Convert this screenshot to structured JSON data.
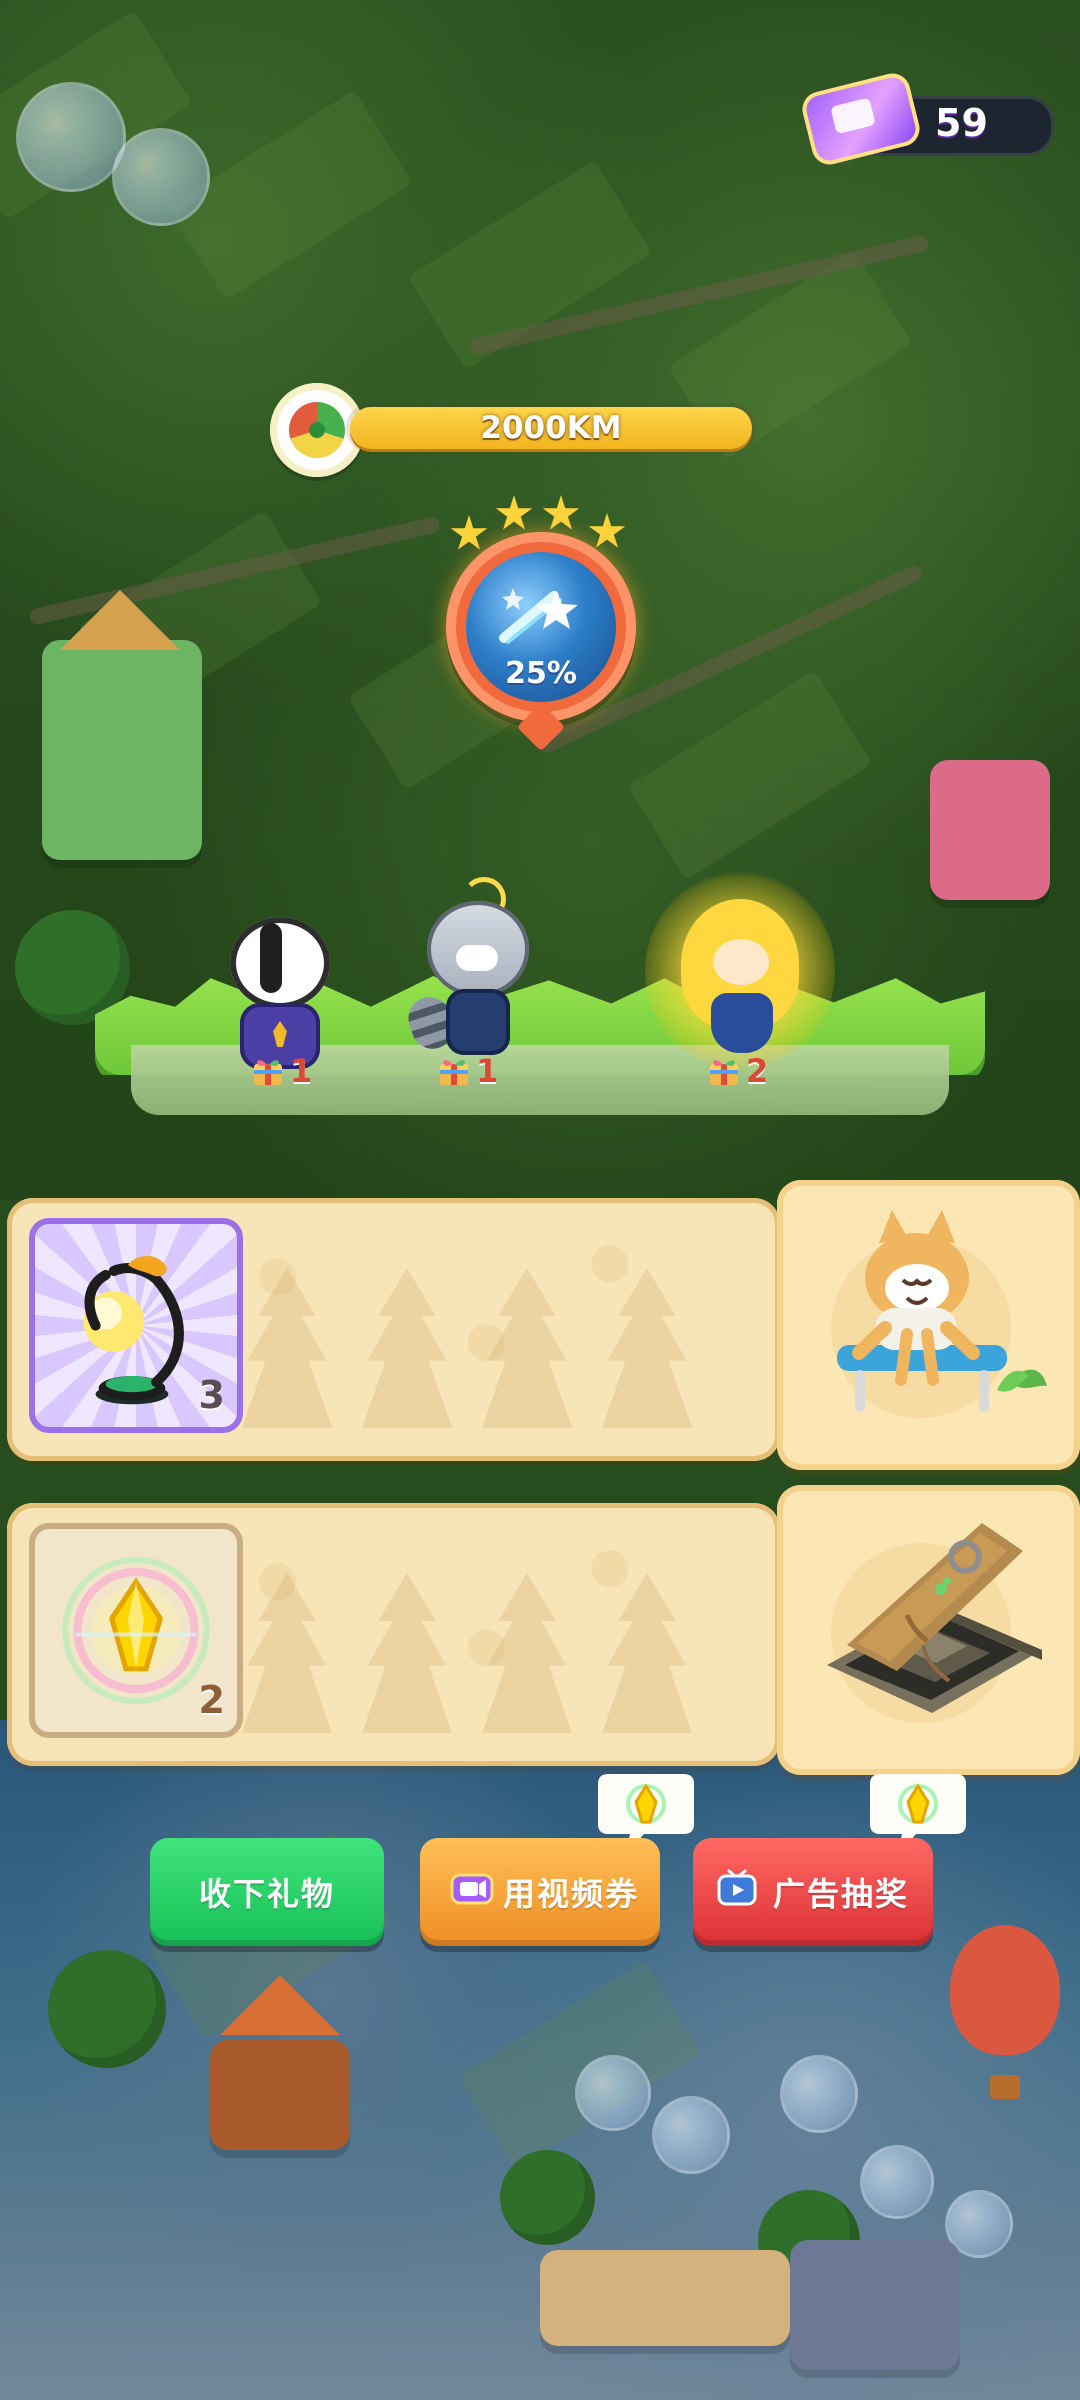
{
  "hud": {
    "ticket_count": "59"
  },
  "progress": {
    "distance": "2000KM",
    "badge_percent": "25%",
    "stars": 4
  },
  "gifts": [
    {
      "count": "1"
    },
    {
      "count": "1"
    },
    {
      "count": "2"
    }
  ],
  "rewards": [
    {
      "item_count": "3"
    },
    {
      "item_count": "2"
    }
  ],
  "buttons": {
    "collect": "收下礼物",
    "video_ticket": "用视频券",
    "ad_draw": "广告抽奖"
  },
  "icons": {
    "ticket": "video-ticket-icon",
    "gauge": "speedometer-icon",
    "shooting_star": "shooting-star-icon",
    "gift": "gift-icon",
    "lamp": "desk-lamp-icon",
    "crystal": "yellow-crystal-icon",
    "cat_bench": "cat-on-bench-icon",
    "trapdoor": "trapdoor-stairs-icon",
    "tv": "tv-icon"
  },
  "colors": {
    "gold": "#ffd64c",
    "green_button": "#18bf58",
    "orange_button": "#ef8d25",
    "red_button": "#db2f35",
    "ticket_purple": "#9d5cff"
  }
}
